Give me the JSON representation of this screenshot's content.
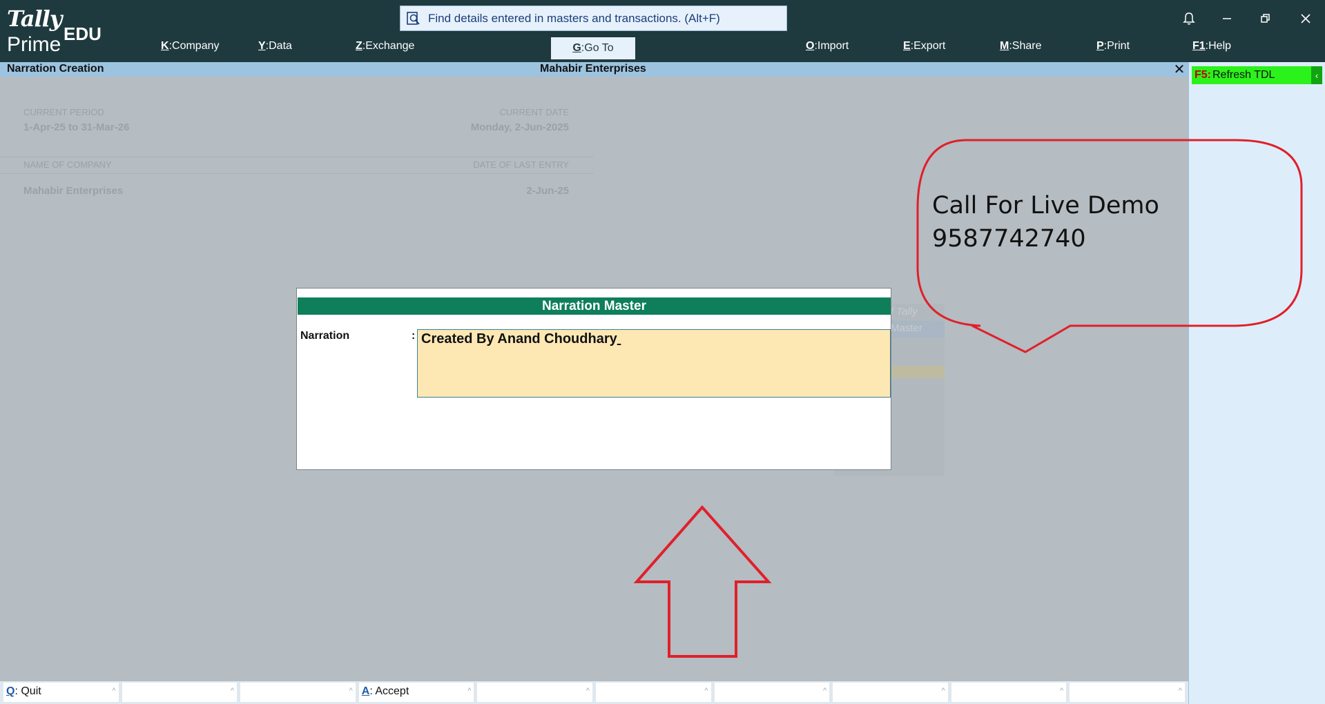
{
  "app": {
    "logo_top": "Tally",
    "logo_bottom": "Prime",
    "edition": "EDU"
  },
  "search": {
    "placeholder": "Find details entered in masters and transactions. (Alt+F)"
  },
  "menu": [
    {
      "key": "K",
      "label": "Company"
    },
    {
      "key": "Y",
      "label": "Data"
    },
    {
      "key": "Z",
      "label": "Exchange"
    },
    {
      "key": "G",
      "label": "Go To"
    },
    {
      "key": "O",
      "label": "Import"
    },
    {
      "key": "E",
      "label": "Export"
    },
    {
      "key": "M",
      "label": "Share"
    },
    {
      "key": "P",
      "label": "Print"
    },
    {
      "key": "F1",
      "label": "Help"
    }
  ],
  "window": {
    "screen_title": "Narration Creation",
    "company_title": "Mahabir Enterprises"
  },
  "background": {
    "current_period_label": "CURRENT PERIOD",
    "current_period_value": "1-Apr-25 to 31-Mar-26",
    "current_date_label": "CURRENT DATE",
    "current_date_value": "Monday, 2-Jun-2025",
    "company_label": "NAME OF COMPANY",
    "company_value": "Mahabir Enterprises",
    "last_entry_label": "DATE OF LAST ENTRY",
    "last_entry_value": "2-Jun-25",
    "ghost_text_1": "f Tally",
    "ghost_text_2": "Master"
  },
  "right_panel": {
    "refresh_key": "F5",
    "refresh_label": "Refresh TDL",
    "chevron": "‹"
  },
  "modal": {
    "title": "Narration Master",
    "field_label": "Narration",
    "colon": ":",
    "field_value": "Created By Anand Choudhary"
  },
  "annotation": {
    "line1": "Call For Live Demo",
    "line2": "9587742740",
    "callout_color": "#e0202a"
  },
  "bottom_bar": [
    {
      "key": "Q",
      "label": "Quit"
    },
    {
      "key": "",
      "label": ""
    },
    {
      "key": "",
      "label": ""
    },
    {
      "key": "A",
      "label": "Accept"
    },
    {
      "key": "",
      "label": ""
    },
    {
      "key": "",
      "label": ""
    },
    {
      "key": "",
      "label": ""
    },
    {
      "key": "",
      "label": ""
    },
    {
      "key": "",
      "label": ""
    },
    {
      "key": "",
      "label": ""
    }
  ]
}
